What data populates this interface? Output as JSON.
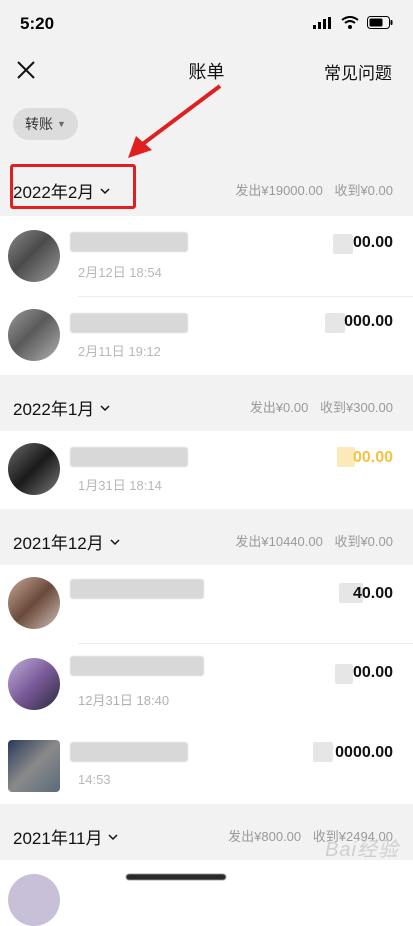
{
  "status": {
    "time": "5:20"
  },
  "nav": {
    "title": "账单",
    "faq": "常见问题"
  },
  "filter": {
    "label": "转账"
  },
  "months": [
    {
      "title": "2022年2月",
      "out": "发出¥19000.00",
      "in": "收到¥0.00",
      "items": [
        {
          "time": "2月12日 18:54",
          "amount": "00.00"
        },
        {
          "time": "2月11日 19:12",
          "amount": "000.00"
        }
      ]
    },
    {
      "title": "2022年1月",
      "out": "发出¥0.00",
      "in": "收到¥300.00",
      "items": [
        {
          "time": "1月31日 18:14",
          "amount": "00.00"
        }
      ]
    },
    {
      "title": "2021年12月",
      "out": "发出¥10440.00",
      "in": "收到¥0.00",
      "items": [
        {
          "time": "",
          "amount": "40.00"
        },
        {
          "time": "12月31日 18:40",
          "amount": "00.00"
        },
        {
          "time": "14:53",
          "amount": "0000.00"
        }
      ]
    },
    {
      "title": "2021年11月",
      "out": "发出¥800.00",
      "in": "收到¥2494.00",
      "items": []
    }
  ],
  "watermark": "Bai经验",
  "colors": {
    "annotation": "#e02020",
    "background": "#f2f2f2",
    "accent_amount": "#f5c242"
  }
}
